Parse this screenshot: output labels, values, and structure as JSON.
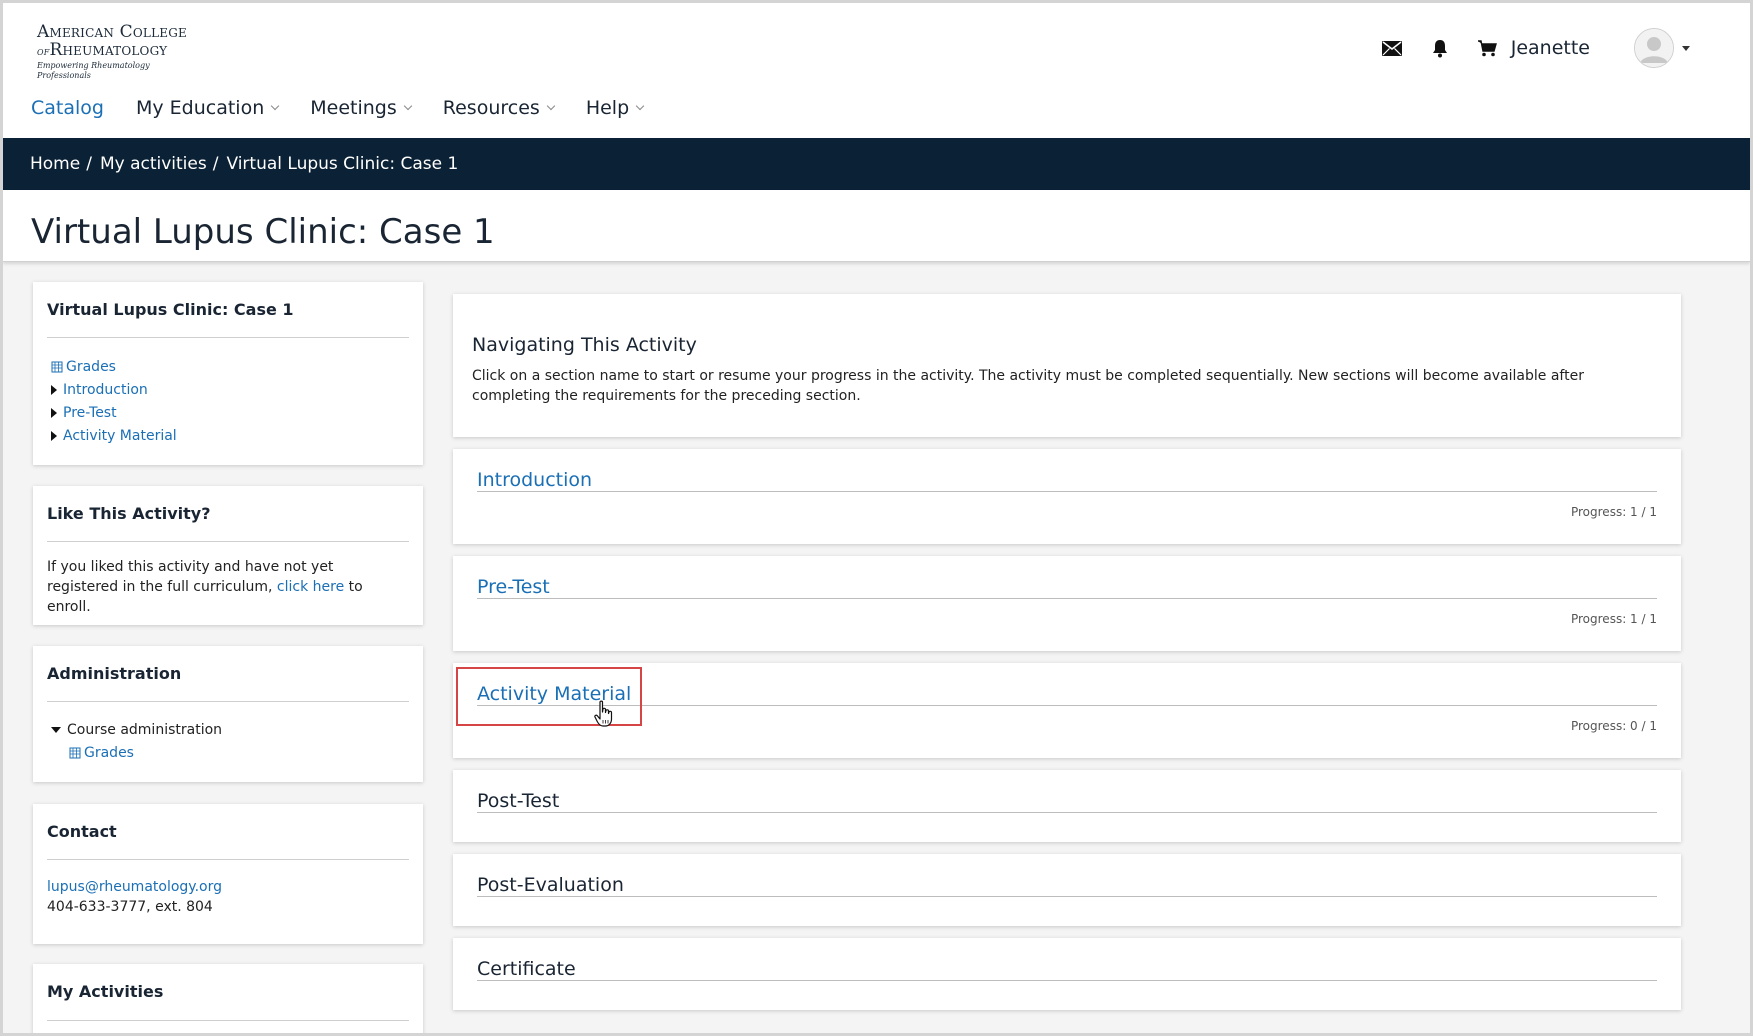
{
  "header": {
    "logo": {
      "line1": "American College",
      "line2_small": "of",
      "line2": "Rheumatology",
      "tagline": "Empowering Rheumatology Professionals"
    },
    "icons": [
      "mail-icon",
      "bell-icon",
      "cart-icon"
    ],
    "username": "Jeanette"
  },
  "nav": {
    "items": [
      {
        "label": "Catalog",
        "dropdown": false,
        "active": true
      },
      {
        "label": "My Education",
        "dropdown": true
      },
      {
        "label": "Meetings",
        "dropdown": true
      },
      {
        "label": "Resources",
        "dropdown": true
      },
      {
        "label": "Help",
        "dropdown": true
      }
    ]
  },
  "breadcrumb": {
    "items": [
      "Home",
      "My activities",
      "Virtual Lupus Clinic: Case 1"
    ],
    "separator": "/"
  },
  "page": {
    "title": "Virtual Lupus Clinic: Case 1"
  },
  "sidebar": {
    "course_block": {
      "title": "Virtual Lupus Clinic: Case 1",
      "items": [
        {
          "label": "Grades",
          "icon": "grades-icon"
        },
        {
          "label": "Introduction",
          "icon": "collapsed-arrow-icon"
        },
        {
          "label": "Pre-Test",
          "icon": "collapsed-arrow-icon"
        },
        {
          "label": "Activity Material",
          "icon": "collapsed-arrow-icon"
        }
      ]
    },
    "like_block": {
      "title": "Like This Activity?",
      "text_before": "If you liked this activity and have not yet registered in the full curriculum, ",
      "link": "click here",
      "text_after": " to enroll."
    },
    "admin_block": {
      "title": "Administration",
      "parent": "Course administration",
      "child": "Grades"
    },
    "contact_block": {
      "title": "Contact",
      "email": "lupus@rheumatology.org",
      "phone": "404-633-3777, ext. 804"
    },
    "activities_block": {
      "title": "My Activities"
    }
  },
  "main": {
    "intro": {
      "title": "Navigating This Activity",
      "description": "Click on a section name to start or resume your progress in the activity. The activity must be completed sequentially. New sections will become available after completing the requirements for the preceding section."
    },
    "sections": [
      {
        "name": "Introduction",
        "progress": "Progress: 1 / 1",
        "available": true
      },
      {
        "name": "Pre-Test",
        "progress": "Progress: 1 / 1",
        "available": true
      },
      {
        "name": "Activity Material",
        "progress": "Progress: 0 / 1",
        "available": true,
        "highlighted": true
      },
      {
        "name": "Post-Test",
        "progress": "",
        "available": false
      },
      {
        "name": "Post-Evaluation",
        "progress": "",
        "available": false
      },
      {
        "name": "Certificate",
        "progress": "",
        "available": false
      }
    ]
  },
  "colors": {
    "link": "#1a6fb5",
    "breadcrumb_bg": "#0b2135",
    "highlight": "#d64545"
  }
}
